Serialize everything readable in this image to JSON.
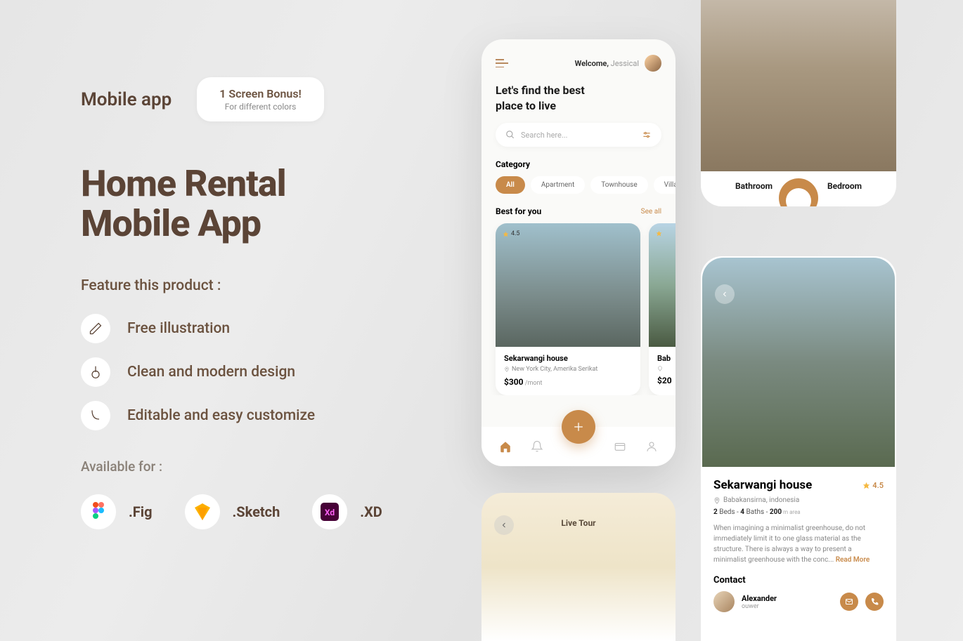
{
  "left": {
    "subtitle": "Mobile app",
    "bonus_title": "1 Screen Bonus!",
    "bonus_sub": "For different colors",
    "hero1": "Home Rental",
    "hero2": "Mobile App",
    "feature_label": "Feature this product :",
    "features": [
      "Free illustration",
      "Clean and modern design",
      "Editable and easy customize"
    ],
    "avail_label": "Available for :",
    "avail": [
      ".Fig",
      ".Sketch",
      ".XD"
    ]
  },
  "phone": {
    "welcome": "Welcome,",
    "name": " Jessical",
    "headline1": "Let's find the best",
    "headline2": "place to live",
    "search_ph": "Search here...",
    "category_label": "Category",
    "chips": [
      "All",
      "Apartment",
      "Townhouse",
      "Villa"
    ],
    "section_title": "Best for you",
    "see_all": "See all",
    "card1_rating": "4.5",
    "card1_title": "Sekarwangi house",
    "card1_loc": "New York City, Amerika Serikat",
    "card1_price": "$300",
    "card1_per": " /mont",
    "card2_title": "Bab",
    "card2_price": "$20"
  },
  "detail": {
    "room1": "Bathroom",
    "room2": "Bedroom"
  },
  "prop": {
    "title": "Sekarwangi house",
    "rating": "4.5",
    "loc": "Babakansirna, indonesia",
    "beds": "2",
    "beds_label": " Beds  -  ",
    "baths": "4",
    "baths_label": " Baths  -  ",
    "area": "200",
    "area_label": " m area",
    "desc": "When imagining a minimalist greenhouse, do not immediately limit it to one glass material as the structure. There is always a way to present a minimalist greenhouse with the conc... ",
    "read_more": "Read More",
    "contact_label": "Contact",
    "contact_name": "Alexander",
    "contact_role": "ouwer"
  },
  "tour": {
    "title": "Live Tour"
  }
}
